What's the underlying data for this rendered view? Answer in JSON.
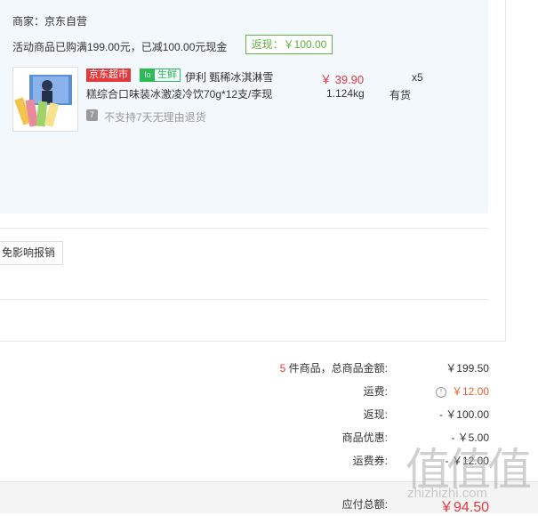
{
  "shop": {
    "seller": "商家：京东自营",
    "promo": "活动商品已购满199.00元，已减100.00元现金",
    "rebate_badge": "返现：￥100.00"
  },
  "product": {
    "tag_supermarket": "京东超市",
    "tag_fresh_icon": "lo",
    "tag_fresh": "生鲜",
    "name_line1": "伊利 甄稀冰淇淋雪",
    "name_line2": "糕综合口味装冰激凌冷饮70g*12支/李现",
    "price": "￥ 39.90",
    "weight": "1.124kg",
    "quantity": "x5",
    "stock": "有货",
    "no_return": "不支持7天无理由退货",
    "no_return_icon": "7"
  },
  "invoice": {
    "button": "免影响报销"
  },
  "summary": {
    "count": "5",
    "count_suffix": " 件商品，总商品金额:",
    "total_goods": "￥199.50",
    "shipping_label": "运费:",
    "shipping_value": "￥12.00",
    "rebate_label": "返现:",
    "rebate_value": "- ￥100.00",
    "discount_label": "商品优惠:",
    "discount_value": "- ￥5.00",
    "coupon_label": "运费券:",
    "coupon_value": "- ￥12.00",
    "payable_label": "应付总额:",
    "payable_value": "￥94.50"
  },
  "watermark": {
    "text_big": "值值值",
    "text_small": "zhizhizhi.com"
  },
  "colors": {
    "accent_red": "#e4393c",
    "green": "#61b042",
    "panel_bg": "#f3f8fd",
    "fresh_green": "#2bbb57"
  }
}
